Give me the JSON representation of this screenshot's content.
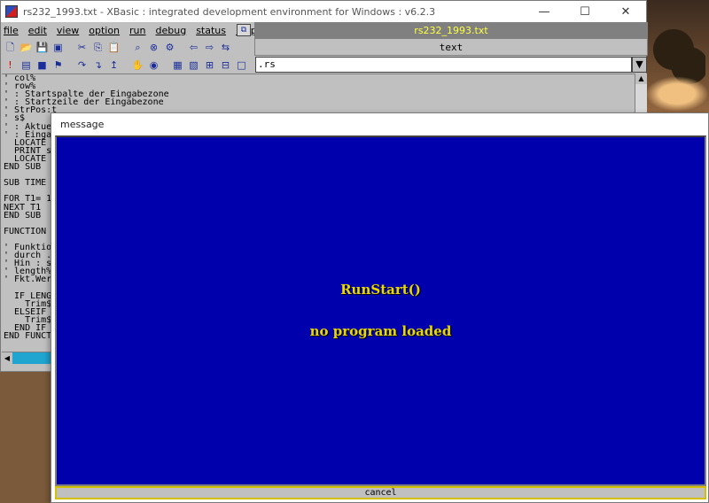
{
  "ide": {
    "title": "rs232_1993.txt - XBasic : integrated development environment for Windows : v6.2.3",
    "window_controls": {
      "minimize": "—",
      "maximize": "☐",
      "close": "✕"
    },
    "menu": [
      "file",
      "edit",
      "view",
      "option",
      "run",
      "debug",
      "status",
      "help"
    ],
    "file_label": "rs232_1993.txt",
    "text_bar": "text",
    "rs_field": ".rs",
    "dropdown_arrow": "▼",
    "code_lines": [
      "' col%",
      "' row%",
      "' : Startspalte der Eingabezone",
      "' : Startzeile der Eingabezone",
      "' StrPos:t",
      "' s$",
      "' : Aktue",
      "' : Einga",
      "  LOCATE",
      "  PRINT s",
      "  LOCATE",
      "END SUB",
      "",
      "SUB TIME",
      "",
      "FOR T1= 1",
      "NEXT T1",
      "END SUB",
      "",
      "FUNCTION",
      "",
      "' Funktio",
      "' durch .",
      "' Hin : s",
      "' length%",
      "' Fkt.Wer",
      "",
      "  IF LENG",
      "    Trim$",
      "  ELSEIF",
      "    Trim$",
      "  END IF",
      "END FUNCT"
    ],
    "toolbar_icons_1": [
      "new-file-icon",
      "open-folder-icon",
      "save-icon",
      "save-all-icon",
      "cut-icon",
      "copy-icon",
      "paste-icon",
      "find-icon",
      "find-replace-icon",
      "compile-icon",
      "run-all-icon"
    ],
    "toolbar_icons_2": [
      "abort-icon",
      "step-icon",
      "stop-icon",
      "breakpoint-icon",
      "step-over-icon",
      "step-into-icon",
      "step-out-icon",
      "hand-icon",
      "assembly-icon",
      "memory-icon",
      "registers-icon",
      "watch-icon",
      "frames-icon",
      "window-icon"
    ]
  },
  "dialog": {
    "title": "message",
    "line1": "RunStart()",
    "line2": "no program loaded",
    "cancel_label": "cancel"
  },
  "colors": {
    "dialog_bg": "#0000ac",
    "dialog_text": "#e8d800",
    "file_label_text": "#ffff40",
    "hscroll": "#1fa5d0"
  }
}
